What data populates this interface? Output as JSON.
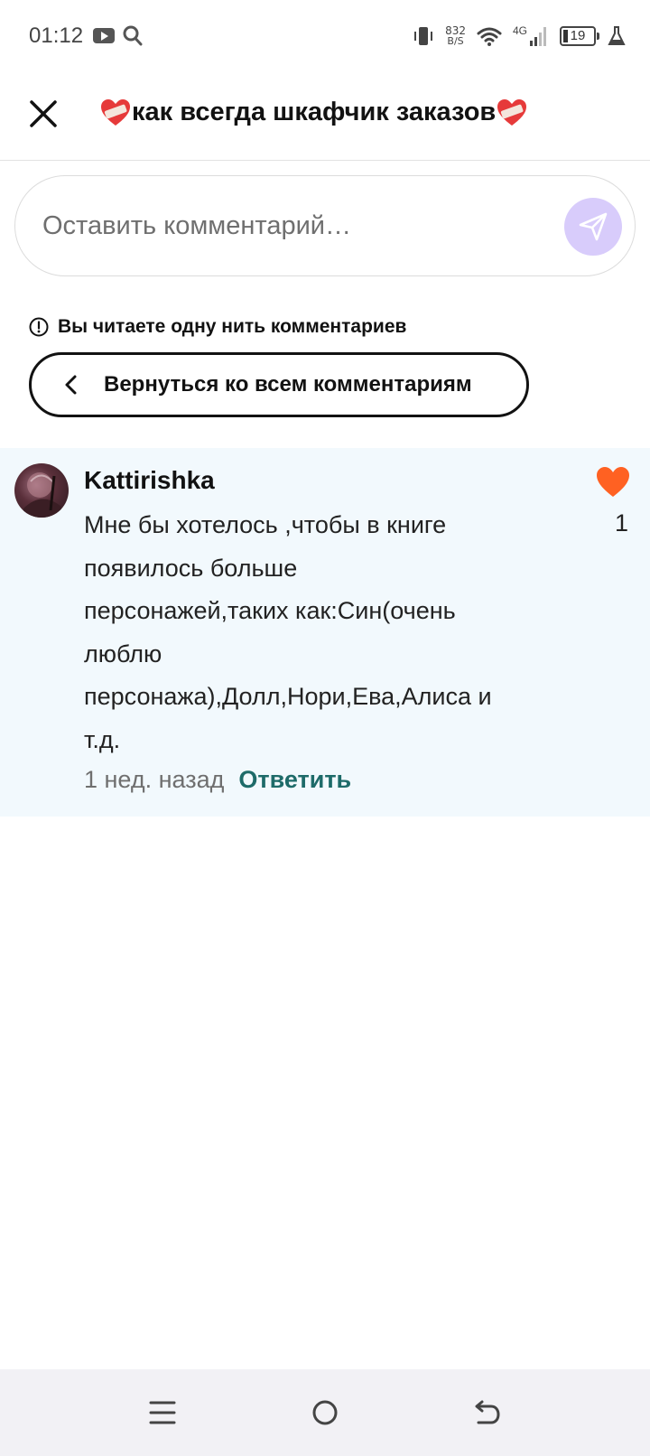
{
  "status_bar": {
    "time": "01:12",
    "net_speed_value": "832",
    "net_speed_unit": "B/S",
    "network_type": "4G",
    "battery": "19",
    "icons": [
      "youtube-icon",
      "search-icon",
      "vibrate-icon",
      "wifi-icon",
      "signal-icon",
      "battery-icon",
      "lab-flask-icon"
    ]
  },
  "header": {
    "title": "как всегда шкафчик заказов",
    "emoji": "❤️‍🩹"
  },
  "comment_input": {
    "placeholder": "Оставить комментарий…"
  },
  "thread": {
    "notice": "Вы читаете одну нить комментариев",
    "back_label": "Вернуться ко всем комментариям"
  },
  "comment": {
    "author": "Kattirishka",
    "lines": [
      "Мне бы хотелось ,чтобы в книге",
      "появилось больше",
      "персонажей,таких как:Син(очень",
      "люблю",
      "персонажа),Долл,Нори,Ева,Алиса и",
      "т.д."
    ],
    "time": "1 нед. назад",
    "reply_label": "Ответить",
    "likes": "1",
    "accent_colors": {
      "like": "#ff6122",
      "reply": "#1e6b69",
      "highlight_bg": "#f2f9fd",
      "send_bg": "#d8ccfb"
    }
  },
  "nav_bar": {
    "icons": [
      "menu-icon",
      "home-circle-icon",
      "back-arrow-icon"
    ]
  }
}
